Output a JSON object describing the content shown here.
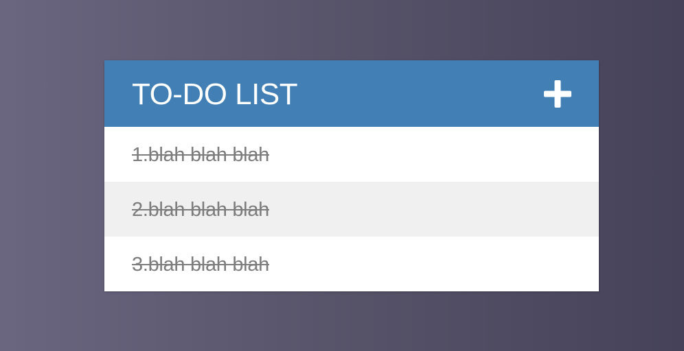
{
  "header": {
    "title": "TO-DO LIST",
    "add_icon": "plus-icon"
  },
  "items": [
    {
      "text": "1.blah blah blah",
      "completed": true
    },
    {
      "text": "2.blah blah blah",
      "completed": true
    },
    {
      "text": "3.blah blah blah",
      "completed": true
    }
  ],
  "colors": {
    "header_bg": "#427fb5",
    "alt_row_bg": "#f0f0f0",
    "completed_text": "#7c7c7c"
  }
}
